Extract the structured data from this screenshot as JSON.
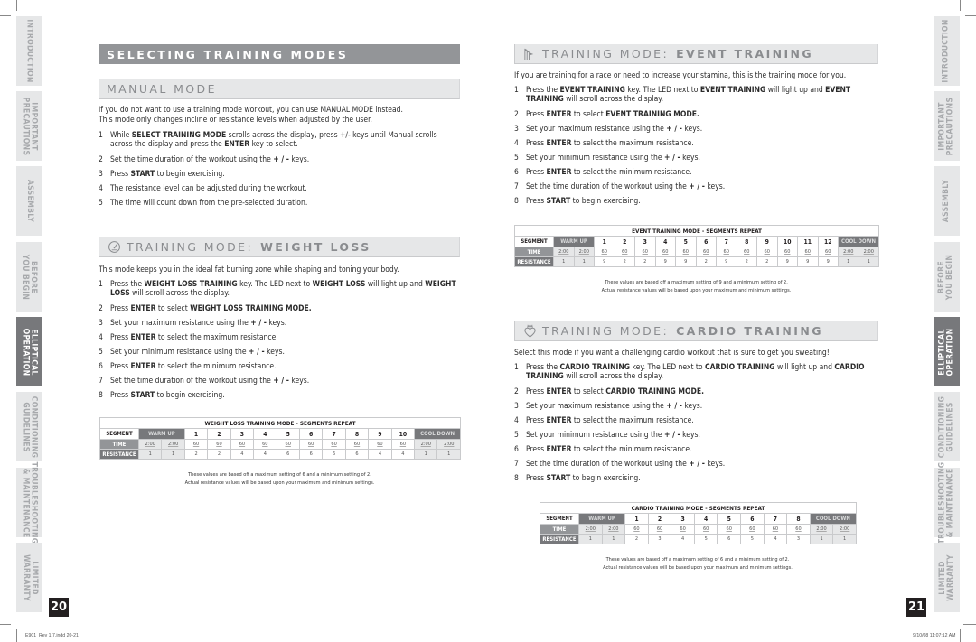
{
  "side_tabs": [
    {
      "label": "INTRODUCTION",
      "active": false
    },
    {
      "label": "IMPORTANT\nPRECAUTIONS",
      "active": false
    },
    {
      "label": "ASSEMBLY",
      "active": false
    },
    {
      "label": "BEFORE\nYOU BEGIN",
      "active": false
    },
    {
      "label": "ELLIPTICAL\nOPERATION",
      "active": true
    },
    {
      "label": "CONDITIONING\nGUIDELINES",
      "active": false
    },
    {
      "label": "TROUBLESHOOTING\n& MAINTENANCE",
      "active": false
    },
    {
      "label": "LIMITED\nWARRANTY",
      "active": false
    }
  ],
  "pages": {
    "left_number": "20",
    "right_number": "21"
  },
  "footer": {
    "left_slug": "E901_Rev 1.7.indd   20-21",
    "right_slug": "9/10/08   11:07:12 AM"
  },
  "left": {
    "section_title": "SELECTING TRAINING MODES",
    "manual": {
      "title": "MANUAL MODE",
      "intro_line1": "If you do not want to use a training mode workout, you can use MANUAL MODE instead.",
      "intro_line2": "This mode only changes incline or resistance levels when adjusted by the user.",
      "steps": [
        {
          "n": "1",
          "html": "While <b>SELECT TRAINING MODE</b> scrolls across the display, press +/- keys until Manual scrolls across the display and press the <b>ENTER</b> key to select."
        },
        {
          "n": "2",
          "html": "Set the time duration of the workout using the <b>+ / -</b> keys."
        },
        {
          "n": "3",
          "html": "Press <b>START</b> to begin exercising."
        },
        {
          "n": "4",
          "html": "The resistance level can be adjusted during the workout."
        },
        {
          "n": "5",
          "html": "The time will count down from the pre-selected duration."
        }
      ]
    },
    "weight_loss": {
      "icon": "gauge-icon",
      "title_prefix": "TRAINING MODE:",
      "title_name": "WEIGHT LOSS",
      "intro": "This mode keeps you in the ideal fat burning zone while shaping and toning your body.",
      "steps": [
        {
          "n": "1",
          "html": "Press the <b>WEIGHT LOSS TRAINING</b> key. The LED next to <b>WEIGHT LOSS</b> will light up and <b>WEIGHT LOSS</b> will scroll across the display."
        },
        {
          "n": "2",
          "html": "Press <b>ENTER</b> to select <b>WEIGHT LOSS TRAINING MODE.</b>"
        },
        {
          "n": "3",
          "html": "Set your maximum resistance using the <b>+ / -</b> keys."
        },
        {
          "n": "4",
          "html": "Press <b>ENTER</b> to select the maximum resistance."
        },
        {
          "n": "5",
          "html": "Set your minimum resistance using the <b>+ / -</b> keys."
        },
        {
          "n": "6",
          "html": "Press <b>ENTER</b> to select the minimum resistance."
        },
        {
          "n": "7",
          "html": "Set the time duration of the workout using the <b>+ / -</b> keys."
        },
        {
          "n": "8",
          "html": "Press <b>START</b> to begin exercising."
        }
      ],
      "table": {
        "title": "WEIGHT LOSS TRAINING MODE - SEGMENTS REPEAT",
        "segment_label": "SEGMENT",
        "time_label": "TIME",
        "resistance_label": "RESISTANCE",
        "warm_up_label": "WARM UP",
        "cool_down_label": "COOL DOWN",
        "segments": [
          "1",
          "2",
          "3",
          "4",
          "5",
          "6",
          "7",
          "8",
          "9",
          "10"
        ],
        "warm_up": {
          "time": [
            "2:00",
            "2:00"
          ],
          "resistance": [
            "1",
            "1"
          ]
        },
        "time": [
          "60",
          "60",
          "60",
          "60",
          "60",
          "60",
          "60",
          "60",
          "60",
          "60"
        ],
        "resistance": [
          "2",
          "2",
          "4",
          "4",
          "6",
          "6",
          "6",
          "6",
          "4",
          "4"
        ],
        "cool_down": {
          "time": [
            "2:00",
            "2:00"
          ],
          "resistance": [
            "1",
            "1"
          ]
        }
      },
      "note_line1": "These values are based off a maximum setting of 6 and a minimum setting of 2.",
      "note_line2": "Actual resistance values will be based upon your maximum and minimum settings."
    }
  },
  "right": {
    "event": {
      "icon": "flags-icon",
      "title_prefix": "TRAINING MODE:",
      "title_name": "EVENT TRAINING",
      "intro": "If you are training for a race or need to increase your stamina, this is the training mode for you.",
      "steps": [
        {
          "n": "1",
          "html": "Press the <b>EVENT TRAINING</b> key. The LED next to <b>EVENT TRAINING</b> will light up and <b>EVENT TRAINING</b> will scroll across the display."
        },
        {
          "n": "2",
          "html": "Press <b>ENTER</b> to select <b>EVENT TRAINING MODE.</b>"
        },
        {
          "n": "3",
          "html": "Set your maximum resistance using the <b>+ / -</b> keys."
        },
        {
          "n": "4",
          "html": "Press <b>ENTER</b> to select the maximum resistance."
        },
        {
          "n": "5",
          "html": "Set your minimum resistance using the <b>+ / -</b> keys."
        },
        {
          "n": "6",
          "html": "Press <b>ENTER</b> to select the minimum resistance."
        },
        {
          "n": "7",
          "html": "Set the time duration of the workout using the <b>+ / -</b> keys."
        },
        {
          "n": "8",
          "html": "Press <b>START</b> to begin exercising."
        }
      ],
      "table": {
        "title": "EVENT TRAINING MODE - SEGMENTS REPEAT",
        "segment_label": "SEGMENT",
        "time_label": "TIME",
        "resistance_label": "RESISTANCE",
        "warm_up_label": "WARM UP",
        "cool_down_label": "COOL DOWN",
        "segments": [
          "1",
          "2",
          "3",
          "4",
          "5",
          "6",
          "7",
          "8",
          "9",
          "10",
          "11",
          "12"
        ],
        "warm_up": {
          "time": [
            "2:00",
            "2:00"
          ],
          "resistance": [
            "1",
            "1"
          ]
        },
        "time": [
          "60",
          "60",
          "60",
          "60",
          "60",
          "60",
          "60",
          "60",
          "60",
          "60",
          "60",
          "60"
        ],
        "resistance": [
          "9",
          "2",
          "2",
          "9",
          "9",
          "2",
          "9",
          "2",
          "2",
          "9",
          "9",
          "9"
        ],
        "cool_down": {
          "time": [
            "2:00",
            "2:00"
          ],
          "resistance": [
            "1",
            "1"
          ]
        }
      },
      "note_line1": "These values are based off a maximum setting of 9 and a minimum setting of 2.",
      "note_line2": "Actual resistance values will be based upon your maximum and minimum settings."
    },
    "cardio": {
      "icon": "heart-flame-icon",
      "title_prefix": "TRAINING MODE:",
      "title_name": "CARDIO TRAINING",
      "intro": "Select this mode if you want a challenging cardio workout that is sure to get you sweating!",
      "steps": [
        {
          "n": "1",
          "html": "Press the <b>CARDIO TRAINING</b> key. The LED next to <b>CARDIO TRAINING</b> will light up and <b>CARDIO TRAINING</b> will scroll across the display."
        },
        {
          "n": "2",
          "html": "Press <b>ENTER</b> to select <b>CARDIO TRAINING MODE.</b>"
        },
        {
          "n": "3",
          "html": "Set your maximum resistance using the <b>+ / -</b> keys."
        },
        {
          "n": "4",
          "html": "Press <b>ENTER</b> to select the maximum resistance."
        },
        {
          "n": "5",
          "html": "Set your minimum resistance using the <b>+ / -</b> keys."
        },
        {
          "n": "6",
          "html": "Press <b>ENTER</b> to select the minimum resistance."
        },
        {
          "n": "7",
          "html": "Set the time duration of the workout using the <b>+ / -</b> keys."
        },
        {
          "n": "8",
          "html": "Press <b>START</b> to begin exercising."
        }
      ],
      "table": {
        "title": "CARDIO TRAINING MODE - SEGMENTS REPEAT",
        "segment_label": "SEGMENT",
        "time_label": "TIME",
        "resistance_label": "RESISTANCE",
        "warm_up_label": "WARM UP",
        "cool_down_label": "COOL DOWN",
        "segments": [
          "1",
          "2",
          "3",
          "4",
          "5",
          "6",
          "7",
          "8"
        ],
        "warm_up": {
          "time": [
            "2:00",
            "2:00"
          ],
          "resistance": [
            "1",
            "1"
          ]
        },
        "time": [
          "60",
          "60",
          "60",
          "60",
          "60",
          "60",
          "60",
          "60"
        ],
        "resistance": [
          "2",
          "3",
          "4",
          "5",
          "6",
          "5",
          "4",
          "3"
        ],
        "cool_down": {
          "time": [
            "2:00",
            "2:00"
          ],
          "resistance": [
            "1",
            "1"
          ]
        }
      },
      "note_line1": "These values are based off a maximum setting of 6 and a minimum setting of 2.",
      "note_line2": "Actual resistance values will be based upon your maximum and minimum settings."
    }
  }
}
